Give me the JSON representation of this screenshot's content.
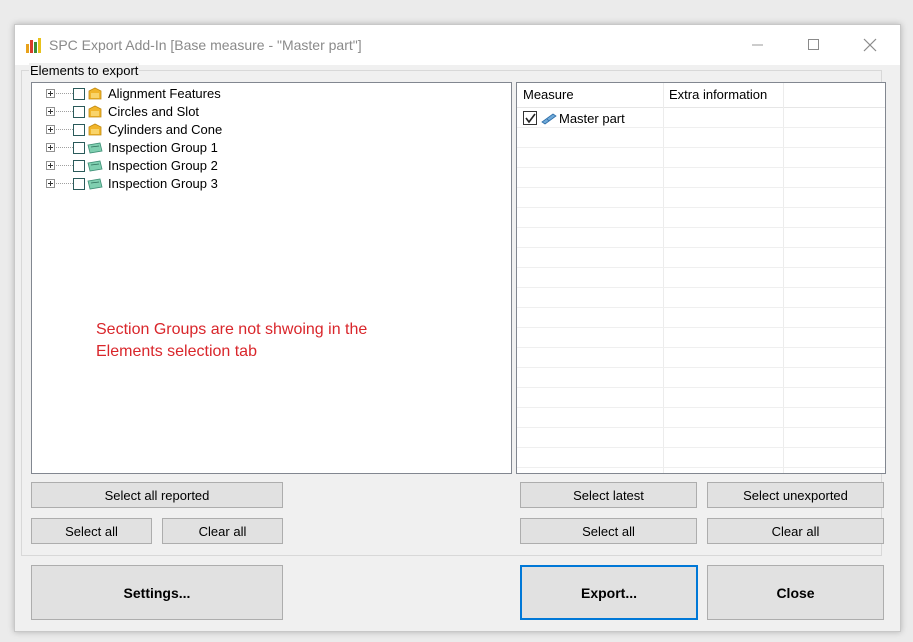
{
  "window": {
    "title": "SPC Export Add-In [Base measure - \"Master part\"]",
    "controls": [
      "minimize",
      "maximize",
      "close"
    ]
  },
  "group": {
    "label": "Elements to export"
  },
  "tree": {
    "items": [
      {
        "label": "Alignment Features",
        "icon": "folder-hand-icon",
        "checked": false
      },
      {
        "label": "Circles and Slot",
        "icon": "folder-hand-icon",
        "checked": false
      },
      {
        "label": "Cylinders and Cone",
        "icon": "folder-hand-icon",
        "checked": false
      },
      {
        "label": "Inspection Group 1",
        "icon": "inspection-group-icon",
        "checked": false
      },
      {
        "label": "Inspection Group 2",
        "icon": "inspection-group-icon",
        "checked": false
      },
      {
        "label": "Inspection Group 3",
        "icon": "inspection-group-icon",
        "checked": false
      }
    ]
  },
  "annotation": {
    "line1": "Section Groups are not shwoing in the",
    "line2": "Elements selection tab",
    "color": "#d9262b"
  },
  "measures": {
    "columns": [
      "Measure",
      "Extra information"
    ],
    "rows": [
      {
        "measure": "Master part",
        "extra": "",
        "checked": true,
        "icon": "measure-icon"
      }
    ]
  },
  "buttons": {
    "select_all_reported": "Select all reported",
    "select_all_left": "Select all",
    "clear_all_left": "Clear all",
    "select_latest": "Select latest",
    "select_unexported": "Select unexported",
    "select_all_right": "Select all",
    "clear_all_right": "Clear all",
    "settings": "Settings...",
    "export": "Export...",
    "close": "Close"
  },
  "colors": {
    "focus_border": "#0078d7",
    "annotation": "#d9262b"
  }
}
